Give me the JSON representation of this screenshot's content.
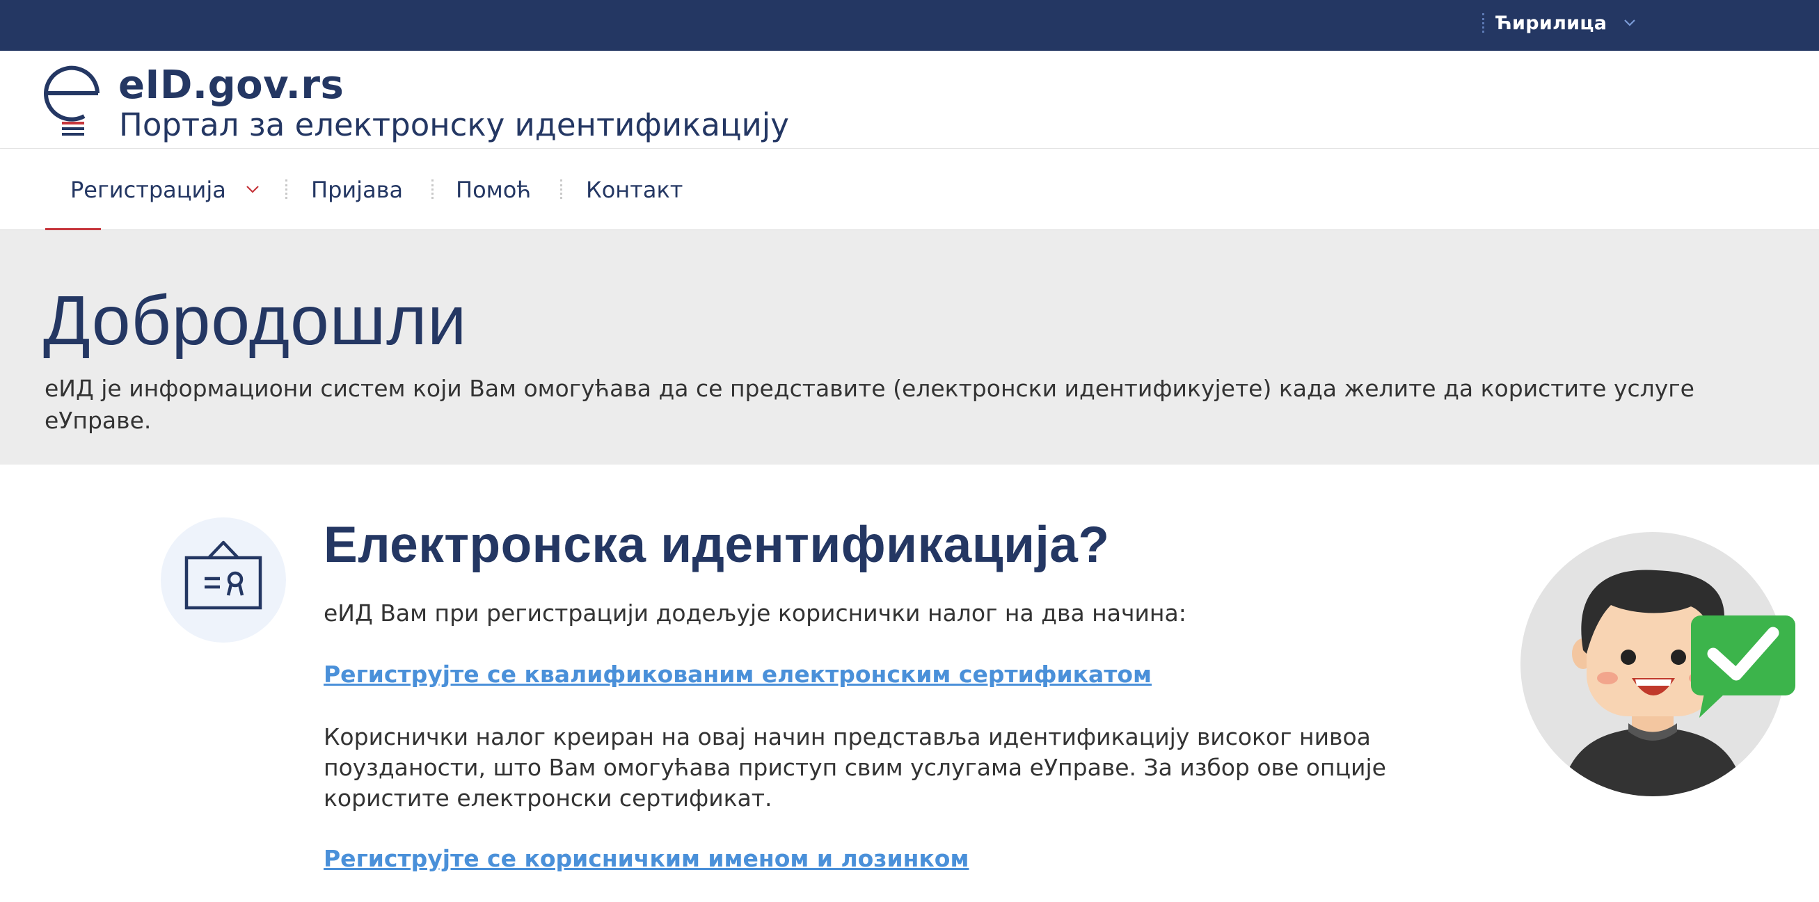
{
  "topbar": {
    "language_label": "Ћирилица"
  },
  "header": {
    "brand_title": "eID.gov.rs",
    "brand_subtitle": "Портал за електронску идентификацију"
  },
  "nav": {
    "items": [
      {
        "label": "Регистрација",
        "has_dropdown": true,
        "active": true
      },
      {
        "label": "Пријава"
      },
      {
        "label": "Помоћ"
      },
      {
        "label": "Контакт"
      }
    ]
  },
  "hero": {
    "title": "Добродошли",
    "text": "еИД је информациони систем који Вам омогућава да се представите (електронски идентификујете) када желите да користите услуге еУправе."
  },
  "main": {
    "title": "Електронска идентификација?",
    "intro": "еИД Вам при регистрацији додељује кориснички налог на два начина:",
    "link_certificate": "Региструјте се квалификованим електронским сертификатом",
    "certificate_text": "Кориснички налог креиран на овај начин представља идентификацију високог нивоа поузданости, што Вам омогућава приступ свим услугама еУправе. За избор ове опције користите електронски сертификат.",
    "link_password": "Региструјте се корисничким именом и лозинком"
  },
  "colors": {
    "navy": "#243763",
    "accent_red": "#c6363c",
    "link_blue": "#4a90d9",
    "hero_bg": "#ececec",
    "check_green": "#3cb44b"
  },
  "icons": {
    "logo": "eid-logo-icon",
    "feature": "id-card-icon",
    "illustration": "user-verified-illustration",
    "chevron": "chevron-down-icon"
  }
}
